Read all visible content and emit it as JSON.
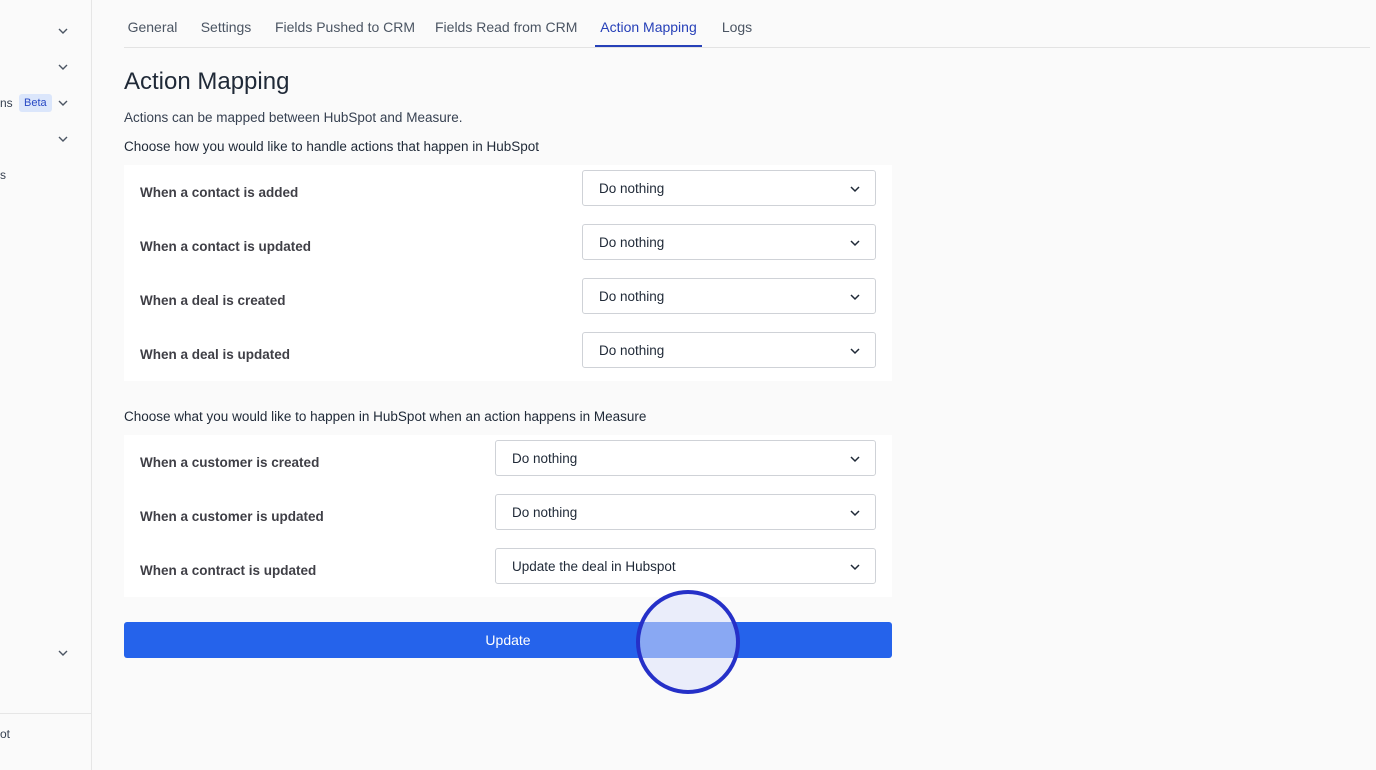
{
  "sidebar": {
    "partial_text_1": "ns",
    "beta_badge": "Beta",
    "partial_text_2": "s",
    "partial_text_3": "ot"
  },
  "tabs": [
    {
      "label": "General"
    },
    {
      "label": "Settings"
    },
    {
      "label": "Fields Pushed to CRM"
    },
    {
      "label": "Fields Read from CRM"
    },
    {
      "label": "Action Mapping",
      "active": true
    },
    {
      "label": "Logs"
    }
  ],
  "page": {
    "title": "Action Mapping",
    "description": "Actions can be mapped between HubSpot and Measure."
  },
  "hubspot_section": {
    "heading": "Choose how you would like to handle actions that happen in HubSpot",
    "rows": [
      {
        "label": "When a contact is added",
        "value": "Do nothing"
      },
      {
        "label": "When a contact is updated",
        "value": "Do nothing"
      },
      {
        "label": "When a deal is created",
        "value": "Do nothing"
      },
      {
        "label": "When a deal is updated",
        "value": "Do nothing"
      }
    ]
  },
  "measure_section": {
    "heading": "Choose what you would like to happen in HubSpot when an action happens in Measure",
    "rows": [
      {
        "label": "When a customer is created",
        "value": "Do nothing"
      },
      {
        "label": "When a customer is updated",
        "value": "Do nothing"
      },
      {
        "label": "When a contract is updated",
        "value": "Update the deal in Hubspot"
      }
    ]
  },
  "update_button": {
    "label": "Update"
  },
  "colors": {
    "accent": "#2640b8",
    "button": "#2563eb",
    "badge_bg": "#dbe6fb"
  }
}
